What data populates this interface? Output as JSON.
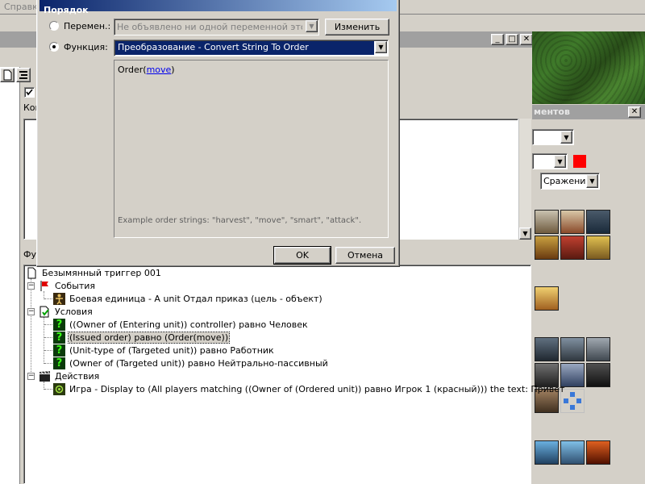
{
  "menu": {
    "help": "Справка"
  },
  "dialog": {
    "title": "Порядок",
    "variable_radio_label": "Перемен.:",
    "variable_combo_value": "Не объявлено ни одной переменной этого тип",
    "change_button": "Изменить",
    "function_radio_label": "Функция:",
    "function_combo_value": "Преобразование - Convert String To Order",
    "param_prefix": "Order(",
    "param_link": "move",
    "param_suffix": ")",
    "example_text": "Example order strings:  \"harvest\", \"move\", \"smart\", \"attack\".",
    "ok_button": "OK",
    "cancel_button": "Отмена"
  },
  "editor": {
    "comment_label": "Ком",
    "functions_label": "Фу",
    "tree": {
      "root": "Безымянный триггер 001",
      "events_label": "События",
      "event_1": "Боевая единица - A unit Отдал приказ (цель - объект)",
      "conditions_label": "Условия",
      "condition_1": "((Owner of (Entering unit)) controller) равно Человек",
      "condition_2": "(Issued order) равно (Order(move))",
      "condition_3": "(Unit-type of (Targeted unit)) равно Работник",
      "condition_4": "(Owner of (Targeted unit)) равно Нейтрально-пассивный",
      "actions_label": "Действия",
      "action_1": "Игра - Display to (All players matching ((Owner of (Ordered unit)) равно Игрок 1 (красный))) the text: Привет"
    }
  },
  "palette": {
    "title": "ментов",
    "category_select": "Сражение",
    "player_color": "#ff0000"
  }
}
